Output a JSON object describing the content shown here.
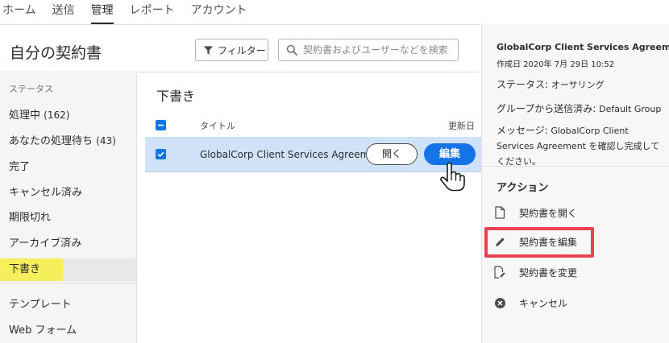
{
  "nav": {
    "items": [
      {
        "label": "ホーム"
      },
      {
        "label": "送信"
      },
      {
        "label": "管理"
      },
      {
        "label": "レポート"
      },
      {
        "label": "アカウント"
      }
    ]
  },
  "header": {
    "title": "自分の契約書",
    "filter_label": "フィルター",
    "search_placeholder": "契約書およびユーザーなどを検索"
  },
  "sidebar": {
    "status_heading": "ステータス",
    "items": [
      {
        "label": "処理中",
        "count": "(162)"
      },
      {
        "label": "あなたの処理待ち",
        "count": "(43)"
      },
      {
        "label": "完了",
        "count": ""
      },
      {
        "label": "キャンセル済み",
        "count": ""
      },
      {
        "label": "期限切れ",
        "count": ""
      },
      {
        "label": "アーカイブ済み",
        "count": ""
      },
      {
        "label": "下書き",
        "count": ""
      }
    ],
    "extra_items": [
      {
        "label": "テンプレート"
      },
      {
        "label": "Web フォーム"
      }
    ]
  },
  "main": {
    "section_title": "下書き",
    "col_title": "タイトル",
    "col_updated": "更新日",
    "row": {
      "title": "GlobalCorp Client Services Agreement",
      "open_label": "開く",
      "edit_label": "編集"
    }
  },
  "panel": {
    "title": "GlobalCorp Client Services Agreement",
    "created": "作成日 2020年 7月 29日 10:52",
    "status_label": "ステータス:",
    "status_value": "オーサリング",
    "group_label": "グループから送信済み:",
    "group_value": "Default Group",
    "message_label": "メッセージ:",
    "message_value": "GlobalCorp Client Services Agreement を確認し完成してください。",
    "actions_heading": "アクション",
    "actions": [
      {
        "label": "契約書を開く",
        "icon": "document-icon"
      },
      {
        "label": "契約書を編集",
        "icon": "pencil-icon"
      },
      {
        "label": "契約書を変更",
        "icon": "document-edit-icon"
      },
      {
        "label": "キャンセル",
        "icon": "cancel-circle-icon"
      }
    ]
  },
  "colors": {
    "accent": "#1473e6",
    "selected_row": "#cfe2f8",
    "highlight_yellow": "#f4ef5a",
    "callout_red": "#e8424f"
  }
}
